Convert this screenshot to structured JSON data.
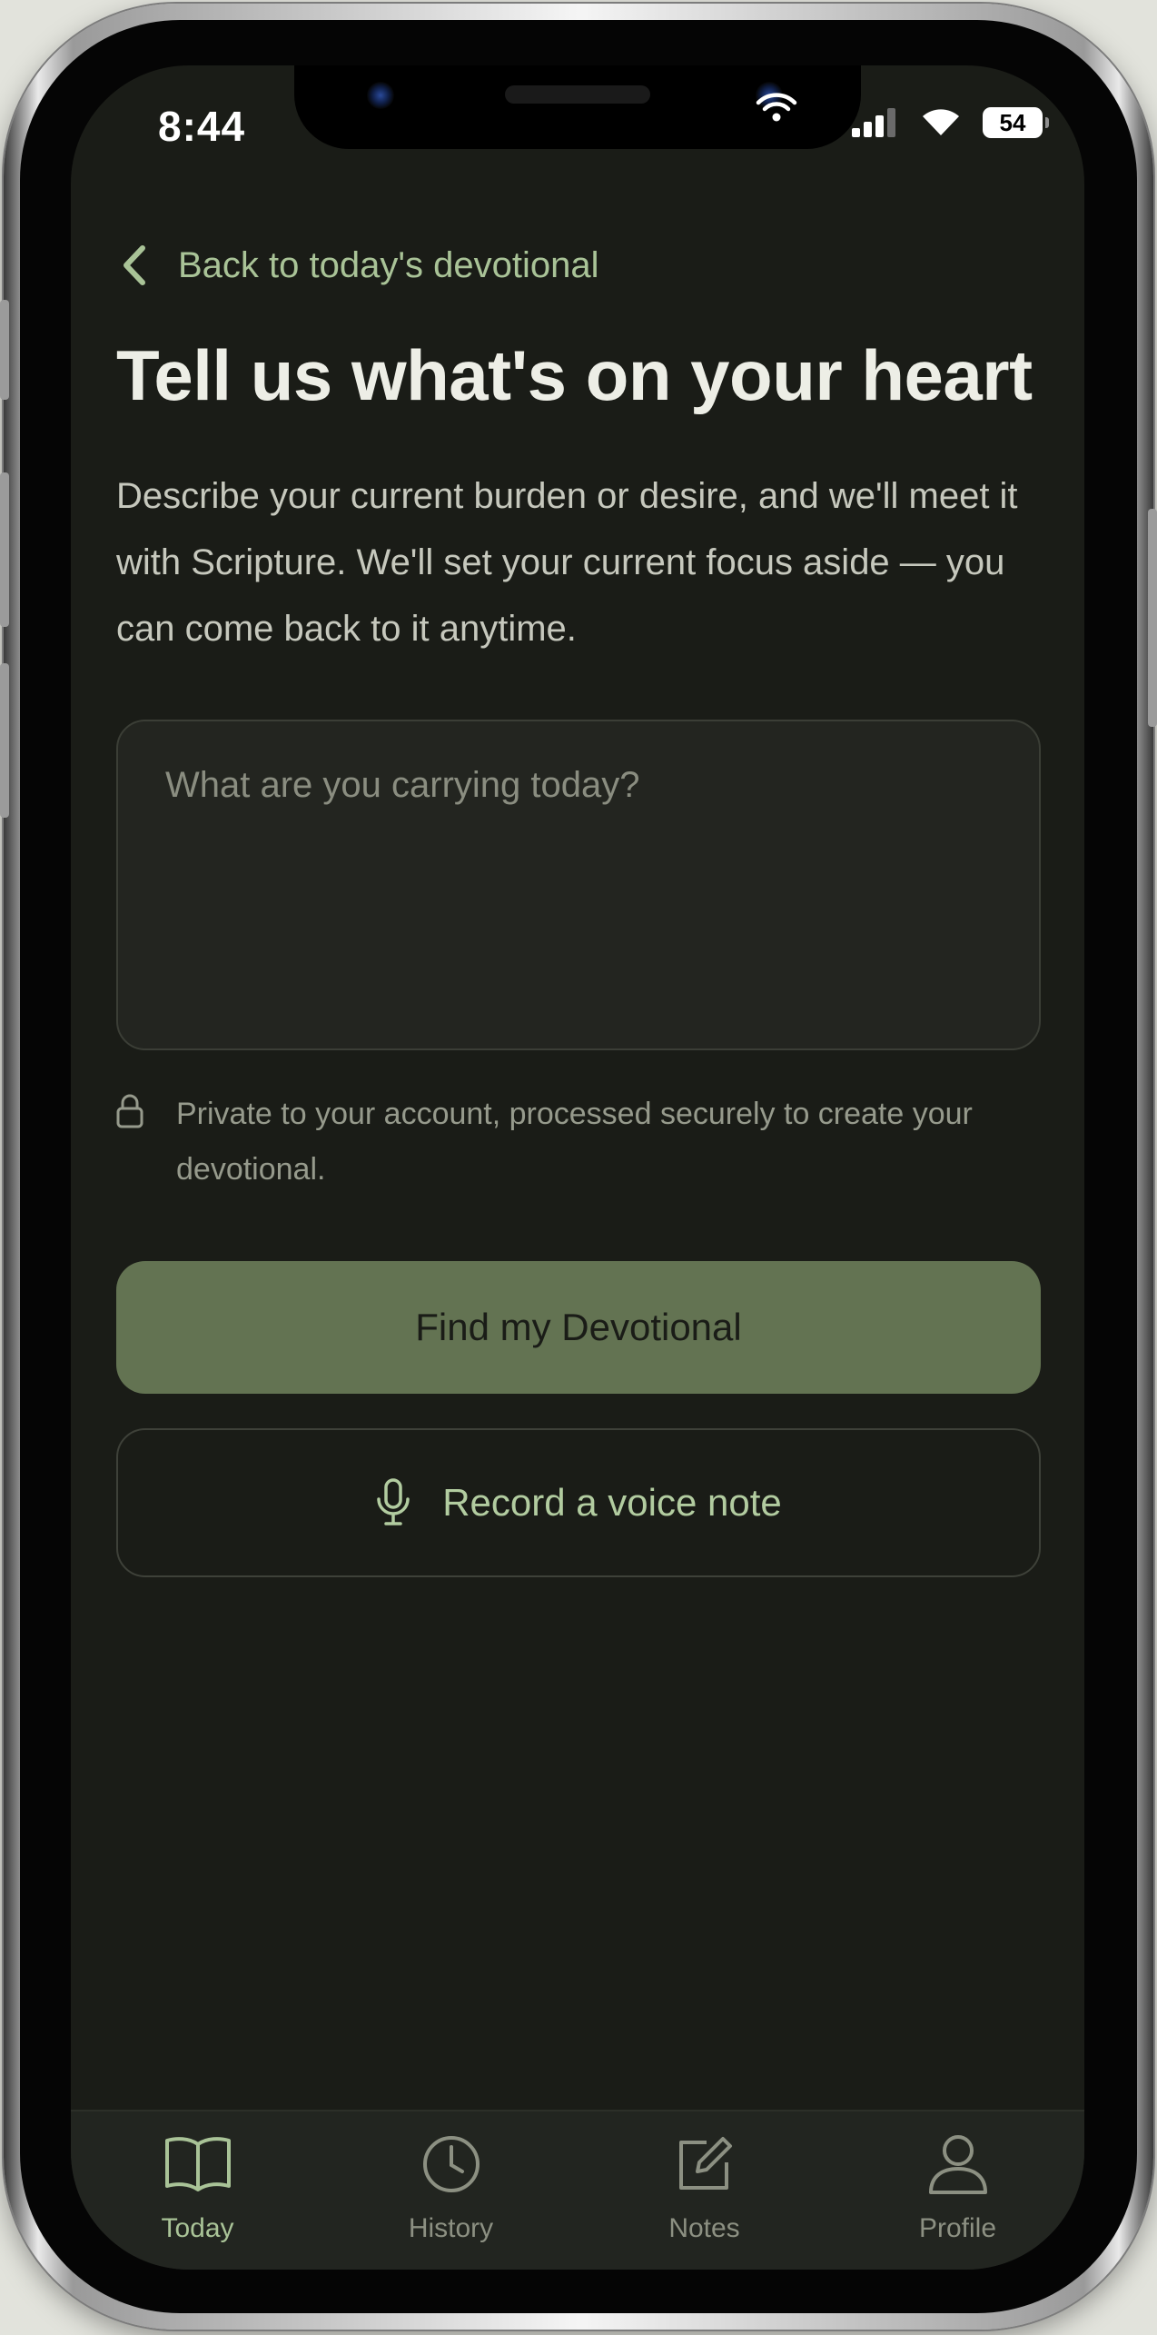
{
  "status_bar": {
    "time": "8:44",
    "battery": "54"
  },
  "back_link": {
    "label": "Back to today's devotional"
  },
  "page": {
    "title": "Tell us what's on your heart",
    "description": "Describe your current burden or desire, and we'll meet it with Scripture. We'll set your current focus aside — you can come back to it anytime."
  },
  "input": {
    "placeholder": "What are you carrying today?",
    "value": ""
  },
  "privacy_note": "Private to your account, processed securely to create your devotional.",
  "buttons": {
    "primary_label": "Find my Devotional",
    "secondary_label": "Record a voice note"
  },
  "tabs": [
    {
      "label": "Today",
      "icon": "book-open-icon",
      "active": true
    },
    {
      "label": "History",
      "icon": "clock-icon",
      "active": false
    },
    {
      "label": "Notes",
      "icon": "edit-note-icon",
      "active": false
    },
    {
      "label": "Profile",
      "icon": "user-icon",
      "active": false
    }
  ],
  "colors": {
    "background": "#1a1c17",
    "accent": "#a9c397",
    "primary_button": "#637352",
    "title": "#edeee6",
    "tab_bar": "#222520"
  }
}
